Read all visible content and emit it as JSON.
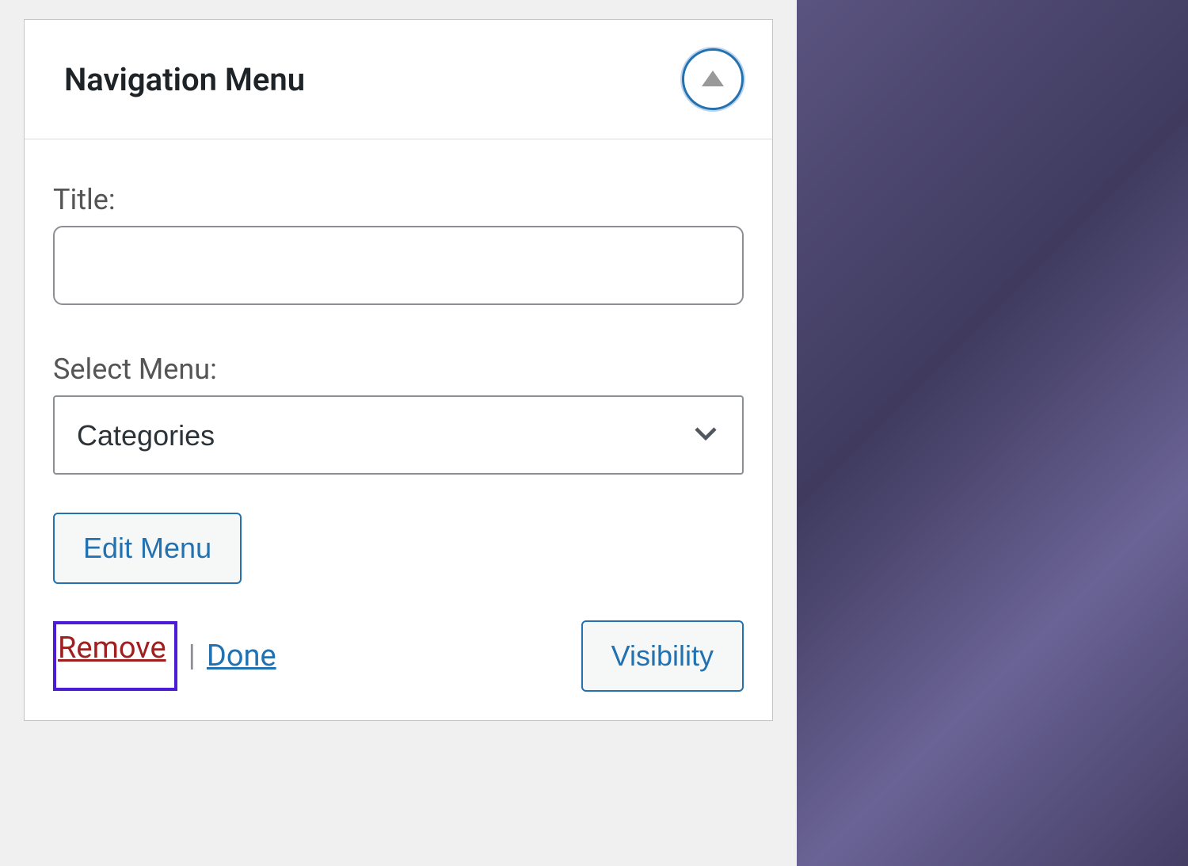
{
  "widget": {
    "title": "Navigation Menu",
    "fields": {
      "title_label": "Title:",
      "title_value": "",
      "select_label": "Select Menu:",
      "select_value": "Categories"
    },
    "buttons": {
      "edit_menu": "Edit Menu",
      "visibility": "Visibility"
    },
    "links": {
      "remove": "Remove",
      "separator": "|",
      "done": "Done"
    }
  }
}
